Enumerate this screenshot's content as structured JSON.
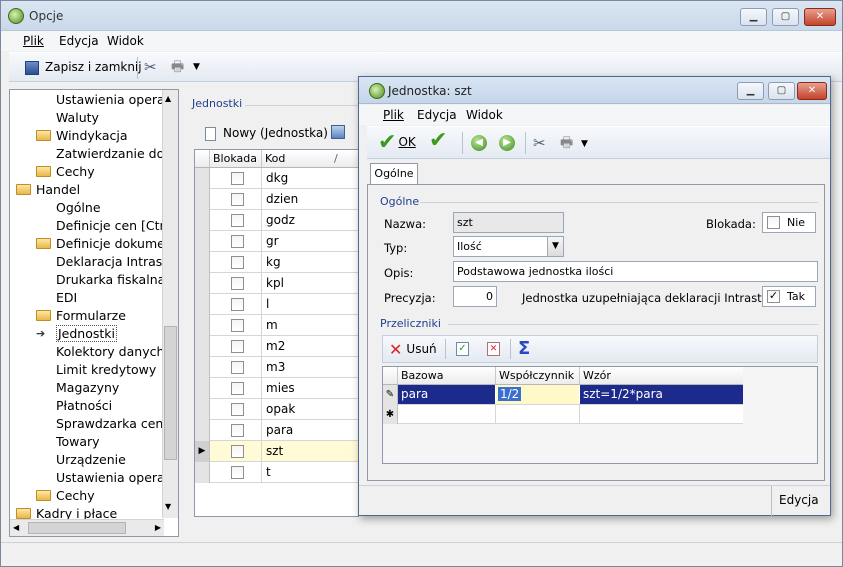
{
  "main": {
    "title": "Opcje",
    "menu": [
      "Plik",
      "Edycja",
      "Widok"
    ],
    "toolbar": {
      "save_close": "Zapisz i zamknij"
    },
    "tree": [
      {
        "label": "Ustawienia operatora",
        "indent": 2,
        "folder": false
      },
      {
        "label": "Waluty",
        "indent": 2,
        "folder": false
      },
      {
        "label": "Windykacja",
        "indent": 2,
        "folder": true
      },
      {
        "label": "Zatwierdzanie dokumentów",
        "indent": 2,
        "folder": false
      },
      {
        "label": "Cechy",
        "indent": 2,
        "folder": true
      },
      {
        "label": "Handel",
        "indent": 0,
        "folder": true
      },
      {
        "label": "Ogólne",
        "indent": 2,
        "folder": false
      },
      {
        "label": "Definicje cen [Ctrl-",
        "indent": 2,
        "folder": false
      },
      {
        "label": "Definicje dokumentów",
        "indent": 2,
        "folder": true
      },
      {
        "label": "Deklaracja Intrastat",
        "indent": 2,
        "folder": false
      },
      {
        "label": "Drukarka fiskalna",
        "indent": 2,
        "folder": false
      },
      {
        "label": "EDI",
        "indent": 2,
        "folder": false
      },
      {
        "label": "Formularze",
        "indent": 2,
        "folder": true
      },
      {
        "label": "Jednostki",
        "indent": 2,
        "folder": false,
        "selected": true
      },
      {
        "label": "Kolektory danych",
        "indent": 2,
        "folder": false
      },
      {
        "label": "Limit kredytowy",
        "indent": 2,
        "folder": false
      },
      {
        "label": "Magazyny",
        "indent": 2,
        "folder": false
      },
      {
        "label": "Płatności",
        "indent": 2,
        "folder": false
      },
      {
        "label": "Sprawdzarka cen",
        "indent": 2,
        "folder": false
      },
      {
        "label": "Towary",
        "indent": 2,
        "folder": false
      },
      {
        "label": "Urządzenie",
        "indent": 2,
        "folder": false
      },
      {
        "label": "Ustawienia operatora",
        "indent": 2,
        "folder": false
      },
      {
        "label": "Cechy",
        "indent": 2,
        "folder": true
      },
      {
        "label": "Kadry i płace",
        "indent": 0,
        "folder": true
      }
    ],
    "panel_label": "Jednostki",
    "new_button": "Nowy (Jednostka)",
    "grid_cols": [
      "Blokada",
      "Kod"
    ],
    "grid_rows": [
      "dkg",
      "dzien",
      "godz",
      "gr",
      "kg",
      "kpl",
      "l",
      "m",
      "m2",
      "m3",
      "mies",
      "opak",
      "para",
      "szt",
      "t"
    ],
    "current_row": "szt"
  },
  "dialog": {
    "title": "Jednostka: szt",
    "menu": [
      "Plik",
      "Edycja",
      "Widok"
    ],
    "ok": "OK",
    "tab": "Ogólne",
    "section1": "Ogólne",
    "nazwa_label": "Nazwa:",
    "nazwa_value": "szt",
    "blokada_label": "Blokada:",
    "blokada_value": "Nie",
    "typ_label": "Typ:",
    "typ_value": "Ilość",
    "opis_label": "Opis:",
    "opis_value": "Podstawowa jednostka ilości",
    "precyzja_label": "Precyzja:",
    "precyzja_value": "0",
    "intrastat_label": "Jednostka uzupełniająca deklaracji Intrastat:",
    "intrastat_value": "Tak",
    "section2": "Przeliczniki",
    "usun": "Usuń",
    "conv_cols": [
      "Bazowa",
      "Współczynnik",
      "Wzór"
    ],
    "conv_row": {
      "bazowa": "para",
      "wspolczynnik": "1/2",
      "wzor": "szt=1/2*para"
    },
    "status": "Edycja"
  }
}
